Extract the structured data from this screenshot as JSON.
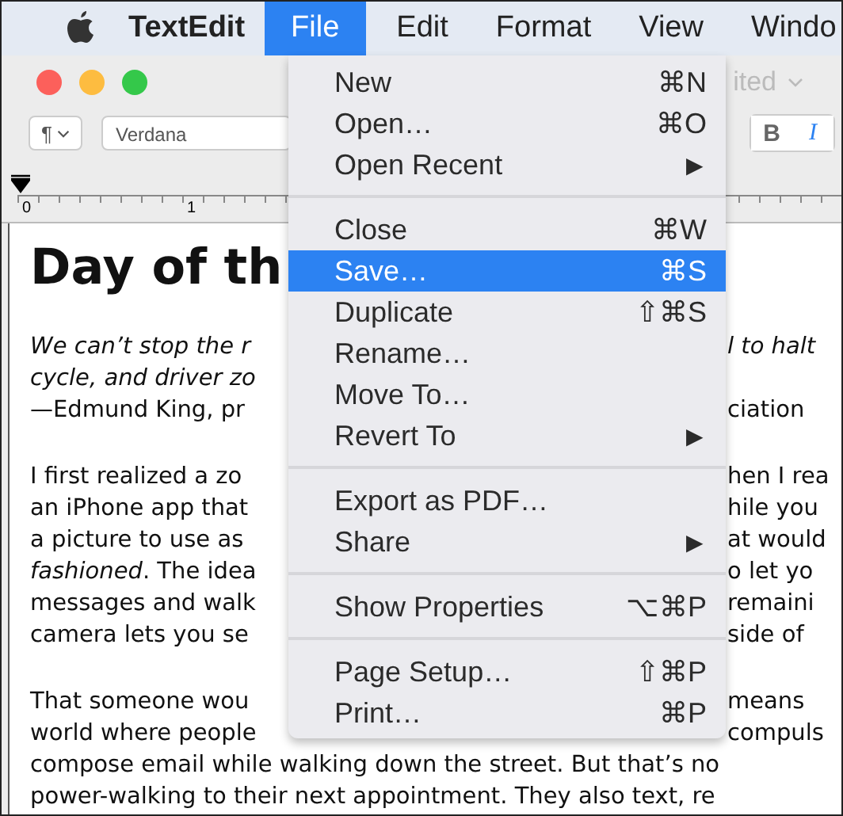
{
  "menubar": {
    "app": "TextEdit",
    "menus": [
      {
        "label": "File",
        "selected": true
      },
      {
        "label": "Edit",
        "selected": false
      },
      {
        "label": "Format",
        "selected": false
      },
      {
        "label": "View",
        "selected": false
      },
      {
        "label": "Windo",
        "selected": false
      }
    ]
  },
  "window": {
    "title": "ited"
  },
  "toolbar": {
    "paragraph_style": "¶",
    "font": "Verdana",
    "bold": "B",
    "italic": "I",
    "italic_active": true
  },
  "ruler": {
    "labels": [
      "0",
      "1"
    ]
  },
  "document": {
    "heading": "Day of th",
    "paragraphs": [
      {
        "lines": [
          {
            "left": "We can’t stop the r",
            "right": "l to halt",
            "italic": true
          },
          {
            "left": "cycle, and driver zo",
            "italic": true
          },
          {
            "left": "—Edmund King, pr",
            "right": "ciation",
            "italic": false
          }
        ]
      },
      {
        "lines": [
          {
            "left": "I first realized a zo",
            "right": "hen I rea",
            "italic": false
          },
          {
            "left": "an iPhone app that",
            "right": "hile you",
            "italic": false
          },
          {
            "left": "a picture to use as",
            "right": "at would",
            "italic": false
          },
          {
            "left": "*fashioned*. The idea",
            "right": "o let yo",
            "italic": false
          },
          {
            "left": "messages and walk",
            "right": "remaini",
            "italic": false
          },
          {
            "left": "camera lets you se",
            "right": "side of",
            "italic": false
          }
        ]
      },
      {
        "lines": [
          {
            "left": "That someone wou",
            "right": "means",
            "italic": false
          },
          {
            "left": "world where people",
            "right": "compuls",
            "italic": false
          },
          {
            "left": "compose email while walking down the street. But that’s no",
            "italic": false
          },
          {
            "left": "power-walking to their next appointment. They also text, re",
            "italic": false
          }
        ]
      }
    ]
  },
  "menu": {
    "items": [
      {
        "kind": "item",
        "label": "New",
        "shortcut": "⌘N",
        "selected": false
      },
      {
        "kind": "item",
        "label": "Open…",
        "shortcut": "⌘O",
        "selected": false
      },
      {
        "kind": "submenu",
        "label": "Open Recent",
        "arrow": "▶",
        "selected": false
      },
      {
        "kind": "separator"
      },
      {
        "kind": "item",
        "label": "Close",
        "shortcut": "⌘W",
        "selected": false
      },
      {
        "kind": "item",
        "label": "Save…",
        "shortcut": "⌘S",
        "selected": true
      },
      {
        "kind": "item",
        "label": "Duplicate",
        "shortcut": "⇧⌘S",
        "selected": false
      },
      {
        "kind": "item",
        "label": "Rename…",
        "selected": false
      },
      {
        "kind": "item",
        "label": "Move To…",
        "selected": false
      },
      {
        "kind": "submenu",
        "label": "Revert To",
        "arrow": "▶",
        "selected": false
      },
      {
        "kind": "separator"
      },
      {
        "kind": "item",
        "label": "Export as PDF…",
        "selected": false
      },
      {
        "kind": "submenu",
        "label": "Share",
        "arrow": "▶",
        "selected": false
      },
      {
        "kind": "separator"
      },
      {
        "kind": "item",
        "label": "Show Properties",
        "shortcut": "⌥⌘P",
        "selected": false
      },
      {
        "kind": "separator"
      },
      {
        "kind": "item",
        "label": "Page Setup…",
        "shortcut": "⇧⌘P",
        "selected": false
      },
      {
        "kind": "item",
        "label": "Print…",
        "shortcut": "⌘P",
        "selected": false
      }
    ]
  }
}
